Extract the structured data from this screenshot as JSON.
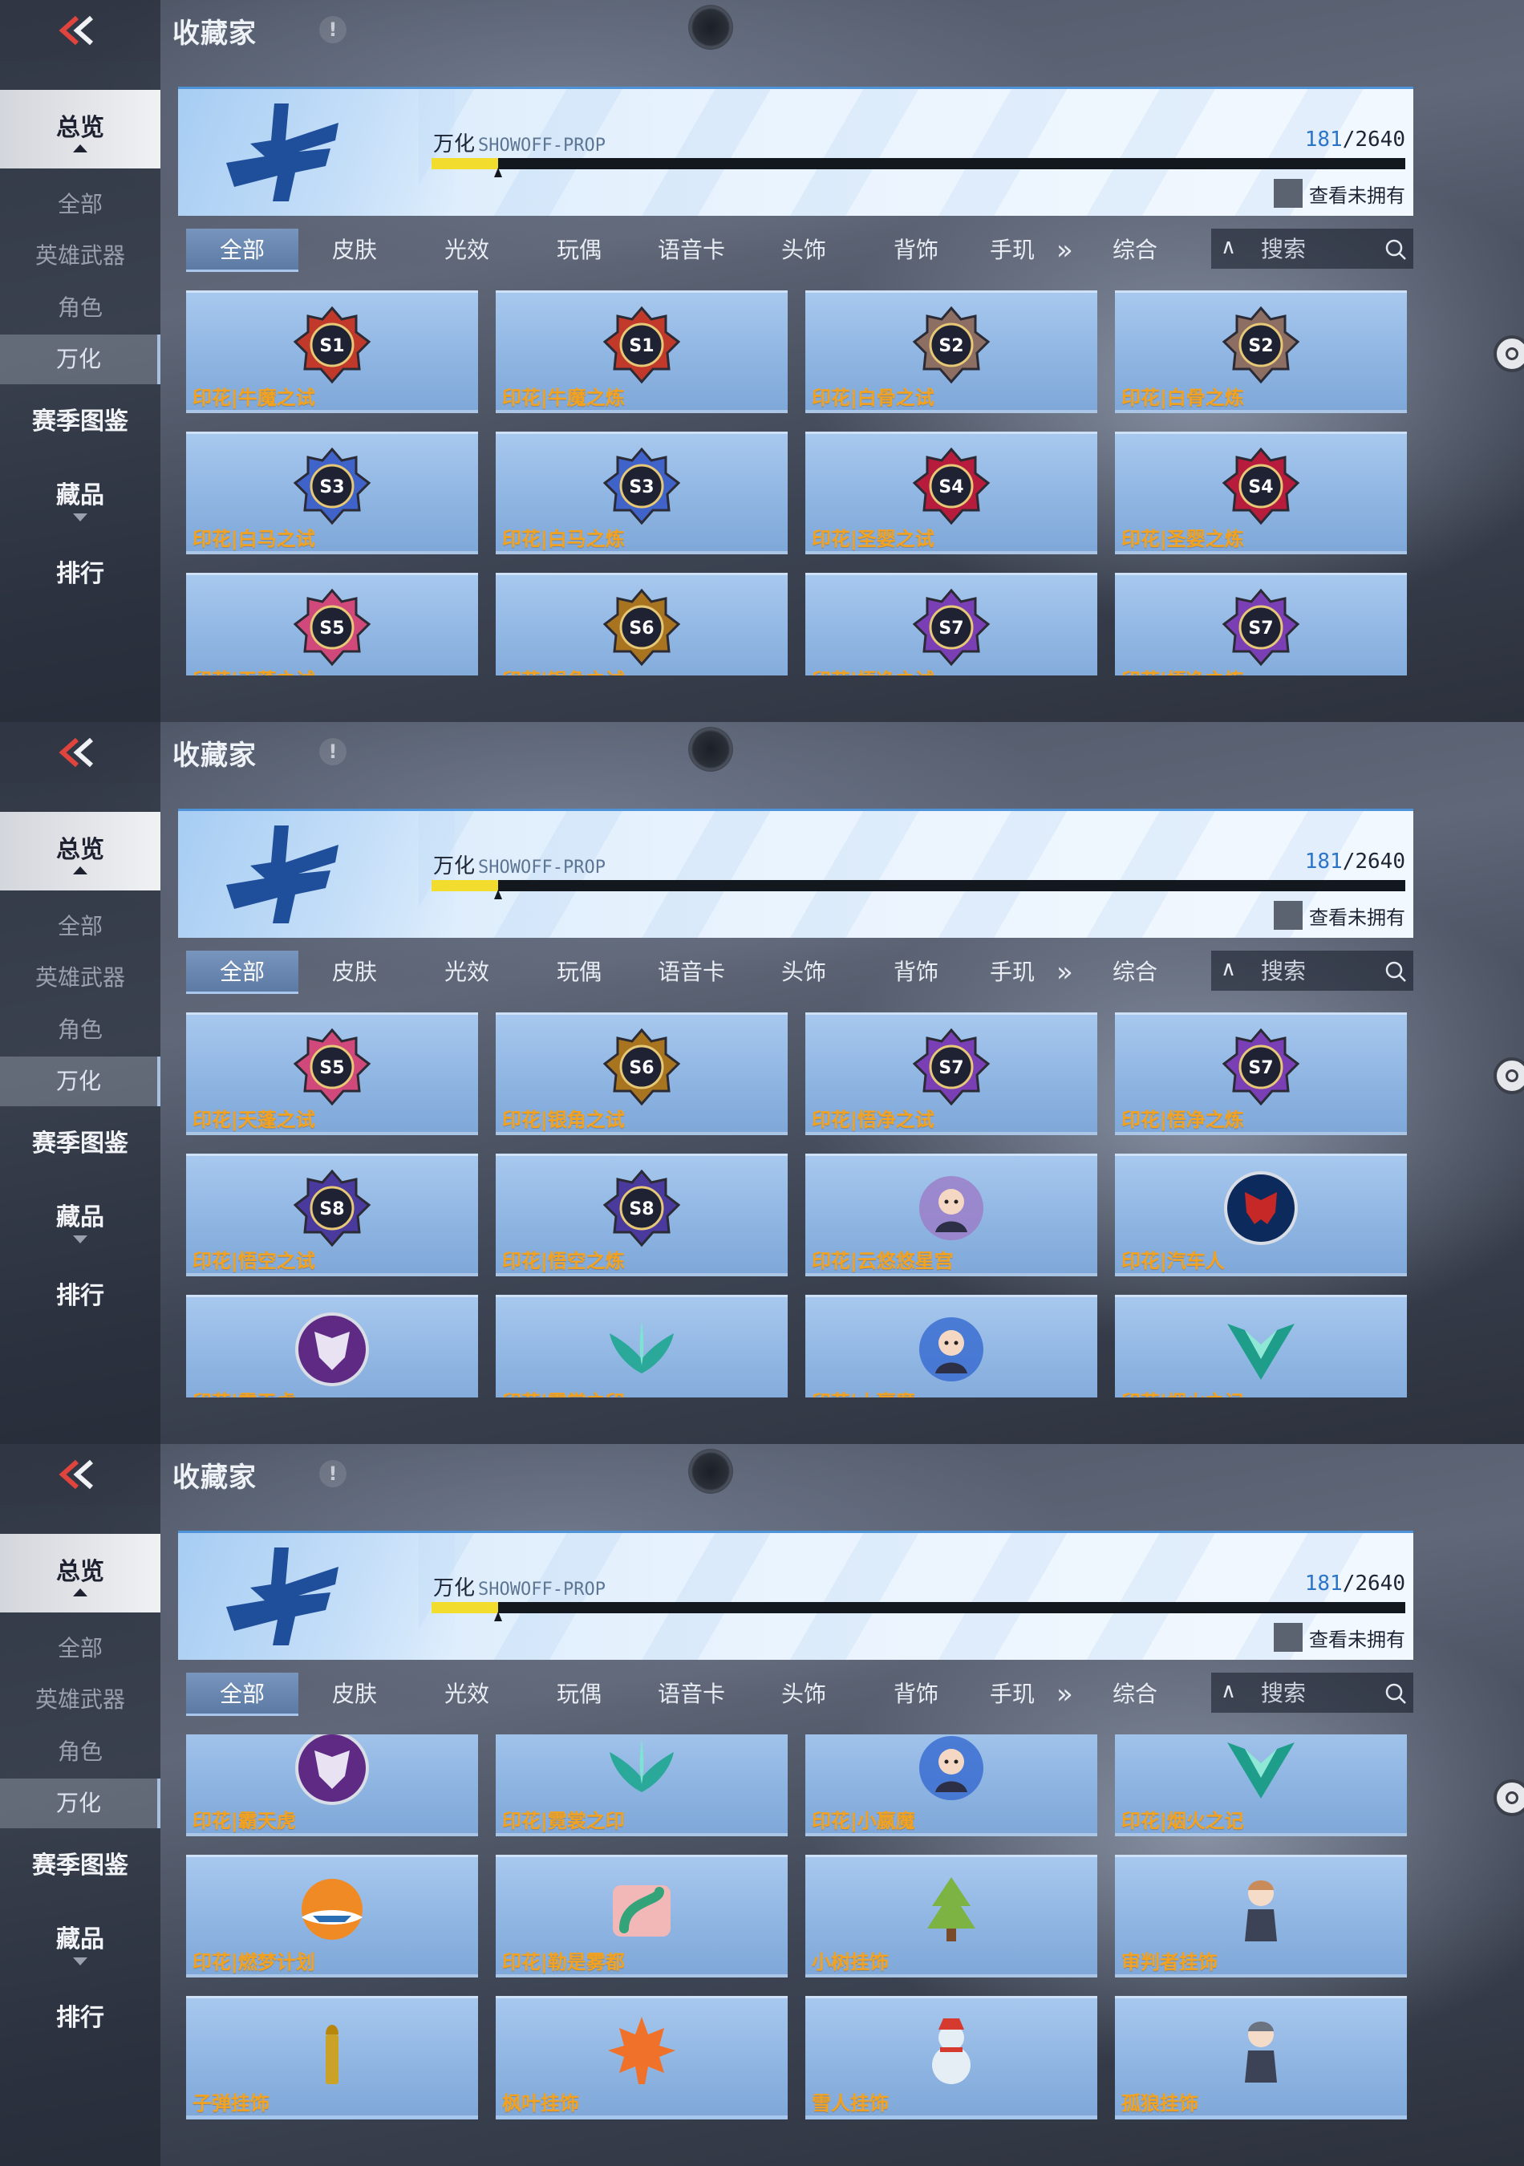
{
  "screens": [
    {
      "header": {
        "title": "收藏家",
        "info_icon": "!"
      },
      "sidebar": {
        "overview": "总览",
        "sub_items": [
          "全部",
          "英雄武器",
          "角色",
          "万化"
        ],
        "season": "赛季图鉴",
        "collection": "藏品",
        "ranking": "排行"
      },
      "banner": {
        "name": "万化",
        "code": "SHOWOFF-PROP",
        "owned": "181",
        "separator": "/",
        "total": "2640",
        "progress_fraction": 0.0687,
        "check_label": "查看未拥有"
      },
      "tabs": [
        "全部",
        "皮肤",
        "光效",
        "玩偶",
        "语音卡",
        "头饰",
        "背饰",
        "手玑"
      ],
      "filter_label": "综合",
      "search_placeholder": "搜索",
      "items": [
        {
          "label": "印花|牛魔之试",
          "icon": "season-s1-badge-icon",
          "color": "#c0392b"
        },
        {
          "label": "印花|牛魔之炼",
          "icon": "season-s1-badge-icon",
          "color": "#c0392b"
        },
        {
          "label": "印花|白骨之试",
          "icon": "season-s2-badge-icon",
          "color": "#8d6e63"
        },
        {
          "label": "印花|白骨之炼",
          "icon": "season-s2-badge-icon",
          "color": "#8d6e63"
        },
        {
          "label": "印花|白马之试",
          "icon": "season-s3-badge-icon",
          "color": "#3f63c9"
        },
        {
          "label": "印花|白马之炼",
          "icon": "season-s3-badge-icon",
          "color": "#3f63c9"
        },
        {
          "label": "印花|圣婴之试",
          "icon": "season-s4-badge-icon",
          "color": "#b71c3c"
        },
        {
          "label": "印花|圣婴之炼",
          "icon": "season-s4-badge-icon",
          "color": "#b71c3c"
        },
        {
          "label": "印花|天蓬之试",
          "icon": "season-s5-badge-icon",
          "color": "#d0497a"
        },
        {
          "label": "印花|银角之试",
          "icon": "season-s6-badge-icon",
          "color": "#a8741f"
        },
        {
          "label": "印花|悟净之试",
          "icon": "season-s7-badge-icon",
          "color": "#7b3fb5"
        },
        {
          "label": "印花|悟净之炼",
          "icon": "season-s7-badge-icon",
          "color": "#7b3fb5"
        }
      ]
    },
    {
      "header": {
        "title": "收藏家",
        "info_icon": "!"
      },
      "sidebar": {
        "overview": "总览",
        "sub_items": [
          "全部",
          "英雄武器",
          "角色",
          "万化"
        ],
        "season": "赛季图鉴",
        "collection": "藏品",
        "ranking": "排行"
      },
      "banner": {
        "name": "万化",
        "code": "SHOWOFF-PROP",
        "owned": "181",
        "separator": "/",
        "total": "2640",
        "progress_fraction": 0.0687,
        "check_label": "查看未拥有"
      },
      "tabs": [
        "全部",
        "皮肤",
        "光效",
        "玩偶",
        "语音卡",
        "头饰",
        "背饰",
        "手玑"
      ],
      "filter_label": "综合",
      "search_placeholder": "搜索",
      "items": [
        {
          "label": "印花|天蓬之试",
          "icon": "season-s5-badge-icon",
          "color": "#d0497a"
        },
        {
          "label": "印花|银角之试",
          "icon": "season-s6-badge-icon",
          "color": "#a8741f"
        },
        {
          "label": "印花|悟净之试",
          "icon": "season-s7-badge-icon",
          "color": "#7b3fb5"
        },
        {
          "label": "印花|悟净之炼",
          "icon": "season-s7-badge-icon",
          "color": "#7b3fb5"
        },
        {
          "label": "印花|悟空之试",
          "icon": "season-s8-badge-icon",
          "color": "#4b3a9e"
        },
        {
          "label": "印花|悟空之炼",
          "icon": "season-s8-badge-icon",
          "color": "#4b3a9e"
        },
        {
          "label": "印花|云悠悠星宫",
          "icon": "character-portrait-icon",
          "color": "#9b7fc9"
        },
        {
          "label": "印花|汽车人",
          "icon": "autobot-emblem-icon",
          "color": "#c62828"
        },
        {
          "label": "印花|霸天虎",
          "icon": "decepticon-emblem-icon",
          "color": "#5e2a84"
        },
        {
          "label": "印花|霓裳之印",
          "icon": "teal-leaf-emblem-icon",
          "color": "#2aa89a"
        },
        {
          "label": "印花|小嬴魔",
          "icon": "little-demon-icon",
          "color": "#3b6fd1"
        },
        {
          "label": "印花|烟火之记",
          "icon": "teal-v-emblem-icon",
          "color": "#1e9e8a"
        }
      ]
    },
    {
      "header": {
        "title": "收藏家",
        "info_icon": "!"
      },
      "sidebar": {
        "overview": "总览",
        "sub_items": [
          "全部",
          "英雄武器",
          "角色",
          "万化"
        ],
        "season": "赛季图鉴",
        "collection": "藏品",
        "ranking": "排行"
      },
      "banner": {
        "name": "万化",
        "code": "SHOWOFF-PROP",
        "owned": "181",
        "separator": "/",
        "total": "2640",
        "progress_fraction": 0.0687,
        "check_label": "查看未拥有"
      },
      "tabs": [
        "全部",
        "皮肤",
        "光效",
        "玩偶",
        "语音卡",
        "头饰",
        "背饰",
        "手玑"
      ],
      "filter_label": "综合",
      "search_placeholder": "搜索",
      "items": [
        {
          "label": "印花|霸天虎",
          "icon": "decepticon-emblem-icon",
          "color": "#5e2a84"
        },
        {
          "label": "印花|霓裳之印",
          "icon": "teal-leaf-emblem-icon",
          "color": "#2aa89a"
        },
        {
          "label": "印花|小嬴魔",
          "icon": "little-demon-icon",
          "color": "#3b6fd1"
        },
        {
          "label": "印花|烟火之记",
          "icon": "teal-v-emblem-icon",
          "color": "#1e9e8a"
        },
        {
          "label": "印花|燃梦计划",
          "icon": "dream-plan-emblem-icon",
          "color": "#f08a24"
        },
        {
          "label": "印花|勒是雾都",
          "icon": "fog-city-emblem-icon",
          "color": "#33a37a"
        },
        {
          "label": "小树挂饰",
          "icon": "tree-charm-icon",
          "color": "#7cb342"
        },
        {
          "label": "审判者挂饰",
          "icon": "judge-charm-icon",
          "color": "#c98b5a"
        },
        {
          "label": "子弹挂饰",
          "icon": "bullet-charm-icon",
          "color": "#c9a227"
        },
        {
          "label": "枫叶挂饰",
          "icon": "maple-leaf-charm-icon",
          "color": "#f0712a"
        },
        {
          "label": "雪人挂饰",
          "icon": "snowman-charm-icon",
          "color": "#e6eef5"
        },
        {
          "label": "孤狼挂饰",
          "icon": "lone-wolf-charm-icon",
          "color": "#6b7280"
        }
      ]
    }
  ]
}
